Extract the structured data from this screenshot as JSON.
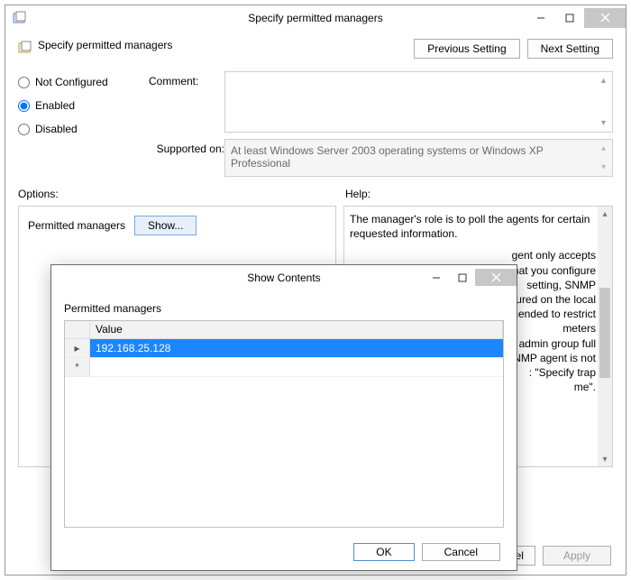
{
  "window": {
    "title": "Specify permitted managers",
    "policy_name": "Specify permitted managers",
    "controls": {
      "min": "–",
      "max": "▢",
      "close": "×"
    }
  },
  "nav": {
    "prev": "Previous Setting",
    "next": "Next Setting"
  },
  "state_radios": {
    "not_configured": "Not Configured",
    "enabled": "Enabled",
    "disabled": "Disabled",
    "selected": "enabled"
  },
  "labels": {
    "comment": "Comment:",
    "supported": "Supported on:",
    "options": "Options:",
    "help": "Help:"
  },
  "supported_on": "At least Windows Server 2003 operating systems or Windows XP Professional",
  "options_panel": {
    "permitted_managers": "Permitted managers",
    "show": "Show..."
  },
  "help_text": {
    "p1": "The manager's role is to poll the agents for certain requested information.",
    "p2a": "gent only accepts",
    "p2b": "s that you configure",
    "p3a": " setting, SNMP",
    "p3b": "ured on the local",
    "p4a": "mmended to restrict",
    "p4b": "meters",
    "p4c": "cal admin group full",
    "p5": "SNMP agent is not",
    "p6a": ": \"Specify trap",
    "p6b": "me\"."
  },
  "main_buttons": {
    "ok": "OK",
    "cancel": "ancel",
    "apply": "Apply"
  },
  "modal": {
    "title": "Show Contents",
    "label": "Permitted managers",
    "col_value": "Value",
    "rows": [
      {
        "marker": "▸",
        "value": "192.168.25.128",
        "selected": true
      },
      {
        "marker": "*",
        "value": "",
        "selected": false
      }
    ],
    "ok": "OK",
    "cancel": "Cancel"
  }
}
